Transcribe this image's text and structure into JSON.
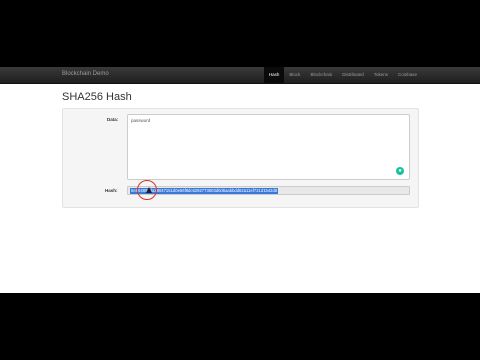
{
  "navbar": {
    "brand": "Blockchain Demo",
    "items": [
      {
        "label": "Hash",
        "active": true
      },
      {
        "label": "Block",
        "active": false
      },
      {
        "label": "Blockchain",
        "active": false
      },
      {
        "label": "Distributed",
        "active": false
      },
      {
        "label": "Tokens",
        "active": false
      },
      {
        "label": "Coinbase",
        "active": false
      }
    ]
  },
  "page": {
    "title": "SHA256 Hash"
  },
  "form": {
    "data_label": "Data:",
    "data_value": "password",
    "hash_label": "Hash:",
    "hash_value": "5e884898da28047151d0e56f8dc6292773603d0d6aabbdd62a11ef721d1542d8"
  },
  "colors": {
    "selection": "#3878d8",
    "cursor_ring": "#d9332b",
    "grammarly": "#15c39a"
  }
}
